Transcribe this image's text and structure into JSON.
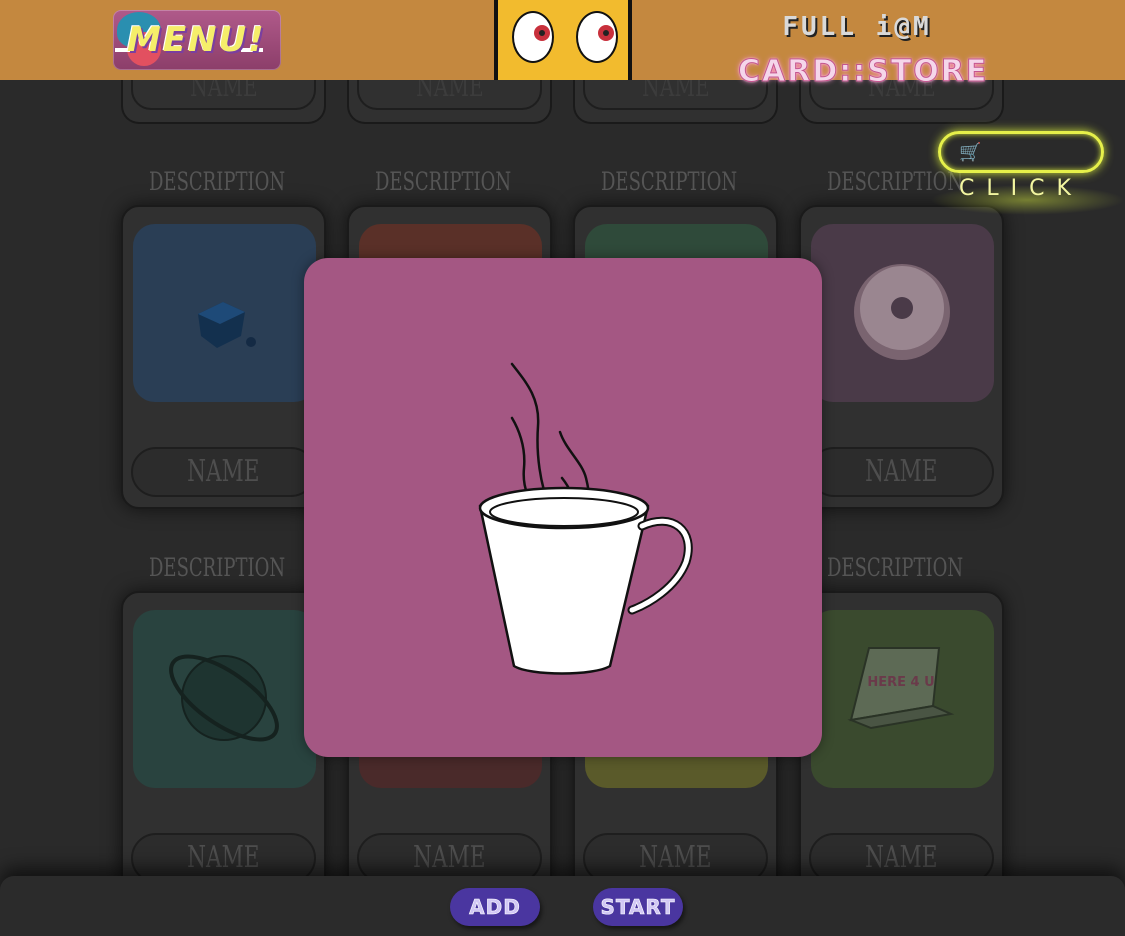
{
  "header": {
    "menu_label": "MENU!",
    "title_top": "FULL i@M",
    "title_bottom": "CARD::STORE",
    "click_label": "CLICK",
    "click_icon": "cart-icon"
  },
  "cards": {
    "description_label": "DESCRIPTION",
    "name_label": "NAME",
    "items": [
      {
        "icon": "cube-icon",
        "color": "#2a3e55"
      },
      {
        "icon": "unknown",
        "color": "#5a3028"
      },
      {
        "icon": "unknown",
        "color": "#2f4a3a"
      },
      {
        "icon": "donut-icon",
        "color": "#4a3a48"
      },
      {
        "icon": "planet-icon",
        "color": "#29433f"
      },
      {
        "icon": "unknown",
        "color": "#4a2a2a"
      },
      {
        "icon": "unknown",
        "color": "#5a5a2a"
      },
      {
        "icon": "pizza-box-icon",
        "color": "#3a4a2e",
        "box_text": "HERE 4 U"
      }
    ]
  },
  "modal": {
    "icon": "coffee-cup-icon",
    "background": "#a45783"
  },
  "footer": {
    "add_label": "ADD",
    "start_label": "START"
  }
}
